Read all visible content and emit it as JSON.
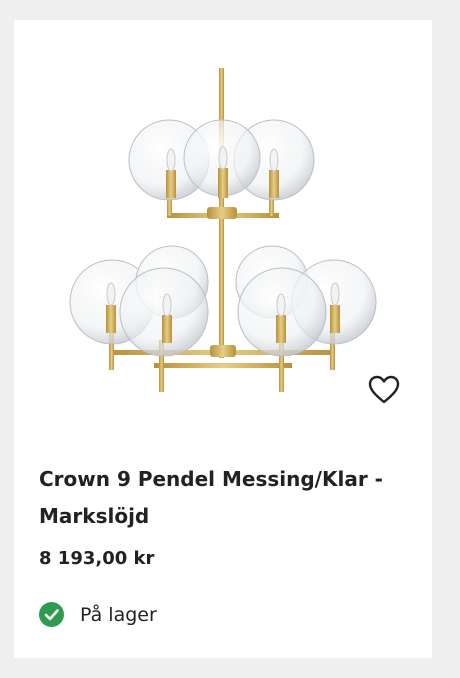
{
  "product": {
    "image_alt": "Crown 9 pendant chandelier with clear glass globes and brass frame",
    "title": "Crown 9 Pendel Messing/Klar - Markslöjd",
    "price": "8 193,00 kr",
    "stock_status": "På lager",
    "wishlist_icon": "heart-outline-icon",
    "stock_icon": "check-circle-icon"
  },
  "colors": {
    "brass": "#c9a74f",
    "stock_green": "#2e9b4f",
    "text": "#222222",
    "background": "#efefef",
    "card": "#ffffff"
  }
}
